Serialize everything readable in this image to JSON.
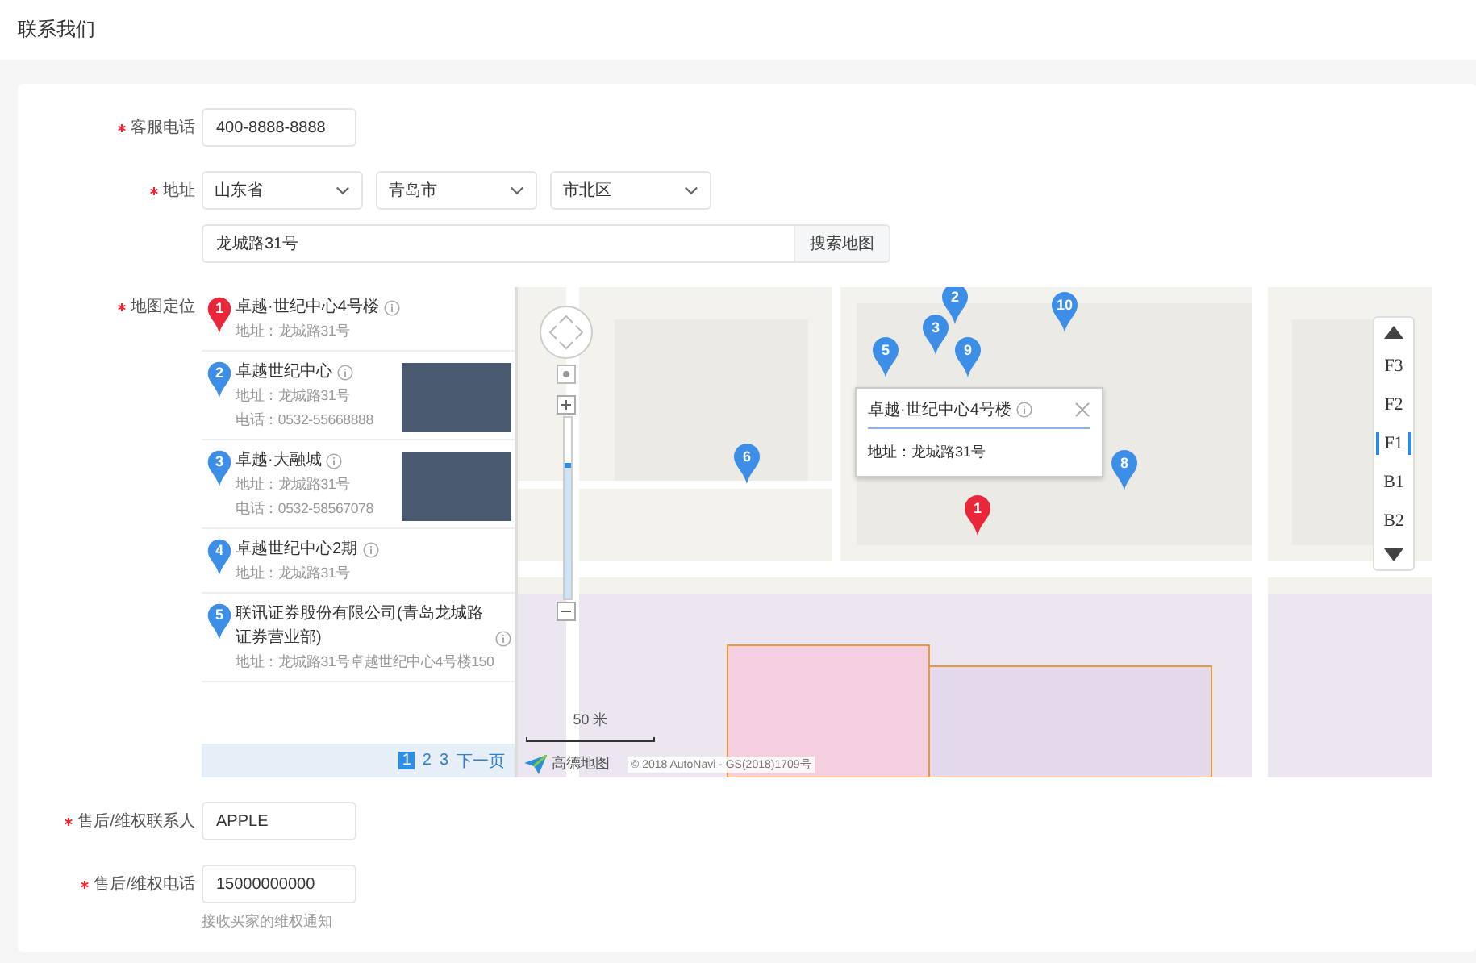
{
  "page": {
    "title": "联系我们"
  },
  "service_phone": {
    "label": "客服电话",
    "required": true,
    "value": "400-8888-8888"
  },
  "address": {
    "label": "地址",
    "required": true,
    "selects": [
      "山东省",
      "青岛市",
      "市北区"
    ],
    "street": "龙城路31号",
    "search_button": "搜索地图"
  },
  "map": {
    "label": "地图定位",
    "required": true,
    "results": [
      {
        "number": "1",
        "name": "卓越·世纪中心4号楼",
        "address": "地址：龙城路31号",
        "selected": true,
        "photo": false
      },
      {
        "number": "2",
        "name": "卓越世纪中心",
        "address": "地址：龙城路31号",
        "phone": "电话：0532-55668888",
        "selected": false,
        "photo": true
      },
      {
        "number": "3",
        "name": "卓越·大融城",
        "address": "地址：龙城路31号",
        "phone": "电话：0532-58567078",
        "selected": false,
        "photo": true
      },
      {
        "number": "4",
        "name": "卓越世纪中心2期",
        "address": "地址：龙城路31号",
        "selected": false,
        "photo": false
      },
      {
        "number": "5",
        "name": "联讯证券股份有限公司(青岛龙城路证券营业部)",
        "address": "地址：龙城路31号卓越世纪中心4号楼150",
        "selected": false,
        "photo": false
      }
    ],
    "pagination": {
      "pages": [
        {
          "label": "1",
          "selected": true
        },
        {
          "label": "2",
          "selected": false
        },
        {
          "label": "3",
          "selected": false
        }
      ],
      "next": "下一页"
    },
    "markers": [
      {
        "label": "2",
        "selected": false
      },
      {
        "label": "3",
        "selected": false
      },
      {
        "label": "10",
        "selected": false
      },
      {
        "label": "5",
        "selected": false
      },
      {
        "label": "9",
        "selected": false
      },
      {
        "label": "6",
        "selected": false
      },
      {
        "label": "8",
        "selected": false
      },
      {
        "label": "1",
        "selected": true
      }
    ],
    "popup": {
      "title": "卓越·世纪中心4号楼",
      "address": "地址：龙城路31号"
    },
    "zoom": {
      "level": 0.72
    },
    "floors": [
      {
        "label": "F3",
        "selected": false
      },
      {
        "label": "F2",
        "selected": false
      },
      {
        "label": "F1",
        "selected": true
      },
      {
        "label": "B1",
        "selected": false
      },
      {
        "label": "B2",
        "selected": false
      }
    ],
    "scale": "50 米",
    "logo": "高德地图",
    "copyright": "© 2018 AutoNavi - GS(2018)1709号"
  },
  "after_sales_contact": {
    "label": "售后/维权联系人",
    "required": true,
    "value": "APPLE"
  },
  "after_sales_phone": {
    "label": "售后/维权电话",
    "required": true,
    "value": "15000000000",
    "hint": "接收买家的维权通知"
  }
}
